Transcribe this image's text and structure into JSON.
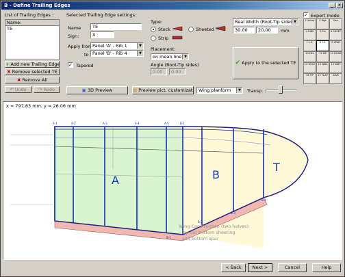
{
  "window": {
    "title": "B - Define Trailing Edges"
  },
  "list": {
    "heading": "List of Trailing Edges :",
    "column": "Name:",
    "items": [
      "TE"
    ],
    "add_btn": "Add new Trailing Edge",
    "remove_btn": "Remove selected TE",
    "remove_all_btn": "Remove All",
    "undo": "Undo",
    "redo": "Redo"
  },
  "settings": {
    "heading": "Selected Trailing Edge settings:",
    "name_label": "Name",
    "name_value": "TE",
    "sign_label": "Sign:",
    "sign_value": "X",
    "apply_from_label": "Apply from",
    "from_value": "Panel 'A' - Rib 1",
    "to_label": "to",
    "to_value": "Panel 'B' - Rib 4",
    "tapered_label": "Tapered",
    "tapered_checked": true
  },
  "type": {
    "label": "Type:",
    "stock": "Stock",
    "strip": "Strip",
    "sheeted": "Sheeted",
    "selected": "Stock"
  },
  "placement": {
    "label": "Placement:",
    "value": "on mean line",
    "angle_label": "Angle (Root-Tip sides)",
    "angle_root": "0.00",
    "angle_tip": "0.00"
  },
  "width": {
    "select": "Real Width (Root-Tip sides):",
    "root": "30.00",
    "tip": "20.00",
    "unit": "mm"
  },
  "apply_btn": "Apply to the selected TE",
  "expert": {
    "label": "Expert mode",
    "checked": true
  },
  "tools": [
    "2 Setup",
    "3 Wgt",
    "Gen",
    "4 RIBS",
    "5 Pnl",
    "6 SHEET",
    "7 L.E.",
    "8 T.E.",
    "9 SPAR",
    "10 DEL",
    "11 DE",
    "12 DOUB",
    "13 HOLE",
    "14 WBA",
    "15 WBT",
    "16 TIP",
    "17 FLAP",
    "SAVE"
  ],
  "toolbar": {
    "preview3d": "3D Preview",
    "preview_custom": "Preview pict. customization",
    "view_select": "Wing planform",
    "transp_label": "Transp. :"
  },
  "canvas": {
    "coords": "x = 797.83 mm, y = 26.06 mm",
    "panels": [
      "A",
      "B",
      "T"
    ],
    "top_ribs": [
      "A-1",
      "A-2",
      "A-3",
      "A-4",
      "A-5",
      "B-1"
    ],
    "bottom_ribs": [
      "B-1",
      "B-2",
      "B-3",
      "B-4"
    ],
    "note_lines": [
      "Wing Construction (two halves):",
      "- lay out bottom sheeting",
      "- add bottom spar"
    ]
  },
  "footer": {
    "back": "< Back",
    "next": "Next >",
    "cancel": "Cancel",
    "help": "Help"
  }
}
